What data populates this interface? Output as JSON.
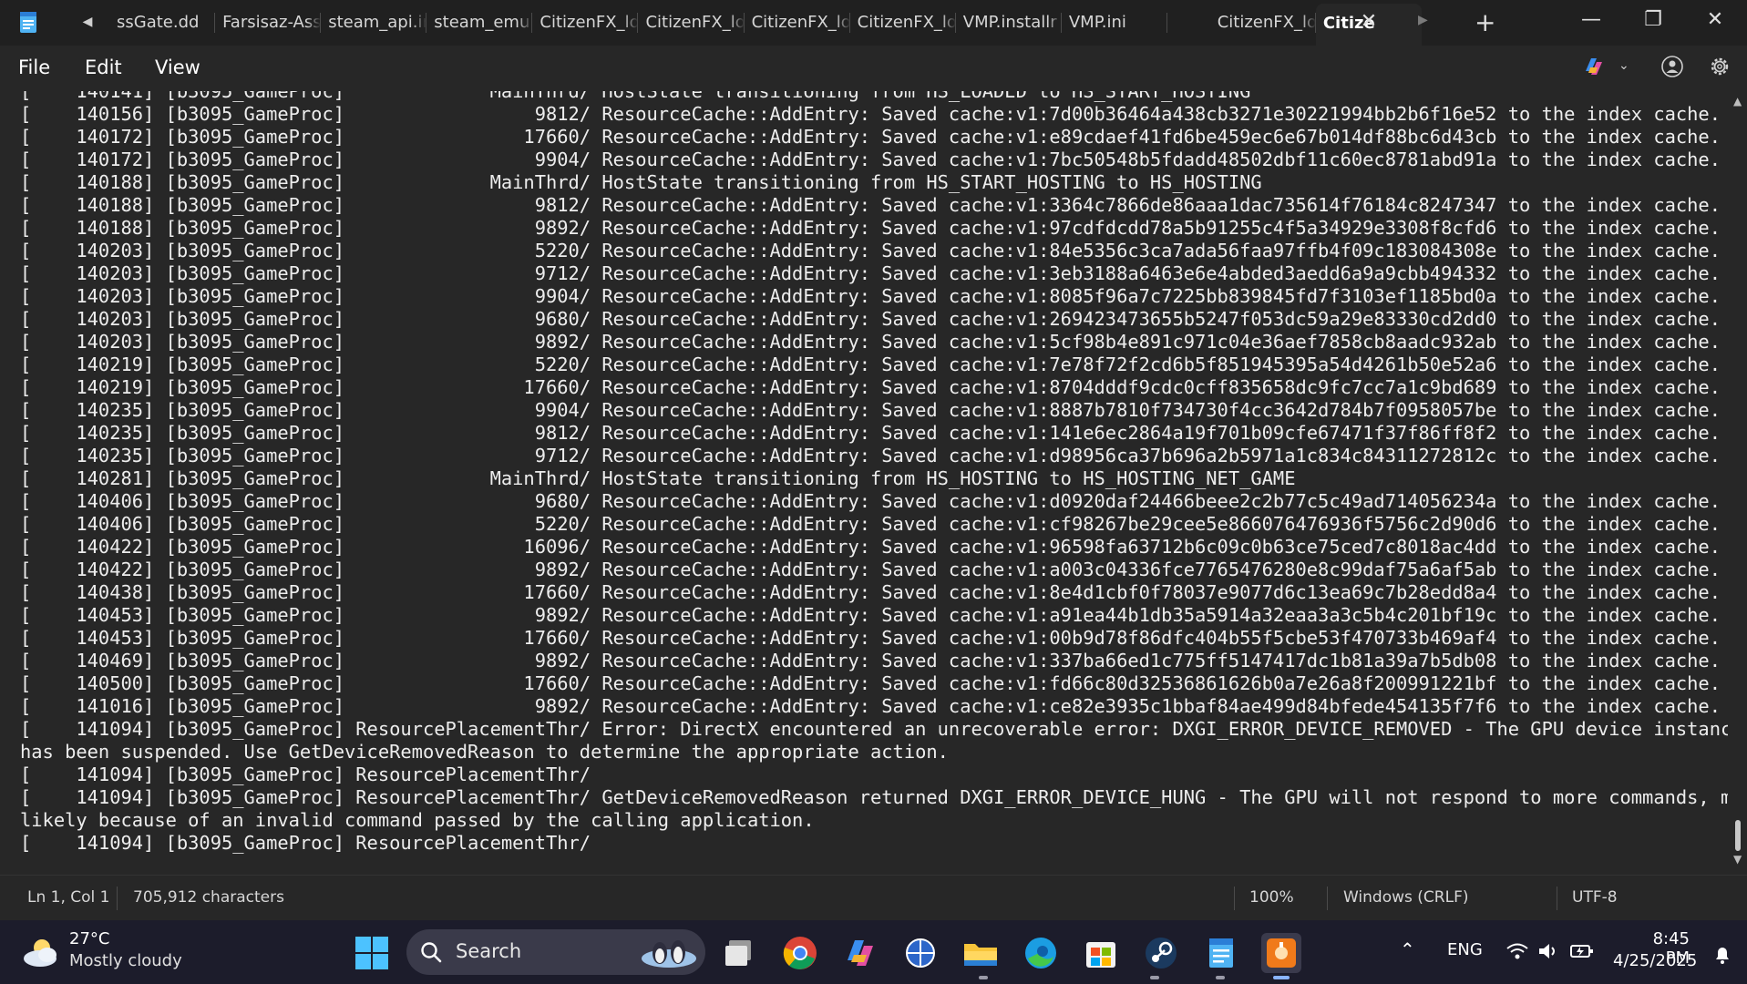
{
  "window": {
    "app": "Notepad",
    "tabs": [
      {
        "label": "ssGate.dd"
      },
      {
        "label": "Farsisaz-Assi"
      },
      {
        "label": "steam_api.in"
      },
      {
        "label": "steam_emu.i"
      },
      {
        "label": "CitizenFX_lo"
      },
      {
        "label": "CitizenFX_lo"
      },
      {
        "label": "CitizenFX_lo"
      },
      {
        "label": "CitizenFX_lo"
      },
      {
        "label": "VMP.installr"
      },
      {
        "label": "VMP.ini"
      },
      {
        "label": ""
      },
      {
        "label": "CitizenFX_lo"
      },
      {
        "label": "Citize"
      }
    ],
    "active_tab_index": 12,
    "close_glyph": "✕",
    "new_tab_glyph": "+",
    "minimize_glyph": "—",
    "restore_glyph": "❐",
    "close_window_glyph": "✕",
    "scroll_left_glyph": "◀",
    "scroll_right_glyph": "▶"
  },
  "menu": {
    "file": "File",
    "edit": "Edit",
    "view": "View"
  },
  "editor": {
    "lines": [
      "[    140141] [b3095_GameProc]             MainThrd/ HostState transitioning from HS_LOADED to HS_START_HOSTING",
      "[    140156] [b3095_GameProc]                 9812/ ResourceCache::AddEntry: Saved cache:v1:7d00b36464a438cb3271e30221994bb2b6f16e52 to the index cache.",
      "[    140172] [b3095_GameProc]                17660/ ResourceCache::AddEntry: Saved cache:v1:e89cdaef41fd6be459ec6e67b014df88bc6d43cb to the index cache.",
      "[    140172] [b3095_GameProc]                 9904/ ResourceCache::AddEntry: Saved cache:v1:7bc50548b5fdadd48502dbf11c60ec8781abd91a to the index cache.",
      "[    140188] [b3095_GameProc]             MainThrd/ HostState transitioning from HS_START_HOSTING to HS_HOSTING",
      "[    140188] [b3095_GameProc]                 9812/ ResourceCache::AddEntry: Saved cache:v1:3364c7866de86aaa1dac735614f76184c8247347 to the index cache.",
      "[    140188] [b3095_GameProc]                 9892/ ResourceCache::AddEntry: Saved cache:v1:97cdfdcdd78a5b91255c4f5a34929e3308f8cfd6 to the index cache.",
      "[    140203] [b3095_GameProc]                 5220/ ResourceCache::AddEntry: Saved cache:v1:84e5356c3ca7ada56faa97ffb4f09c183084308e to the index cache.",
      "[    140203] [b3095_GameProc]                 9712/ ResourceCache::AddEntry: Saved cache:v1:3eb3188a6463e6e4abded3aedd6a9a9cbb494332 to the index cache.",
      "[    140203] [b3095_GameProc]                 9904/ ResourceCache::AddEntry: Saved cache:v1:8085f96a7c7225bb839845fd7f3103ef1185bd0a to the index cache.",
      "[    140203] [b3095_GameProc]                 9680/ ResourceCache::AddEntry: Saved cache:v1:269423473655b5247f053dc59a29e83330cd2dd0 to the index cache.",
      "[    140203] [b3095_GameProc]                 9892/ ResourceCache::AddEntry: Saved cache:v1:5cf98b4e891c971c04e36aef7858cb8aadc932ab to the index cache.",
      "[    140219] [b3095_GameProc]                 5220/ ResourceCache::AddEntry: Saved cache:v1:7e78f72f2cd6b5f851945395a54d4261b50e52a6 to the index cache.",
      "[    140219] [b3095_GameProc]                17660/ ResourceCache::AddEntry: Saved cache:v1:8704dddf9cdc0cff835658dc9fc7cc7a1c9bd689 to the index cache.",
      "[    140235] [b3095_GameProc]                 9904/ ResourceCache::AddEntry: Saved cache:v1:8887b7810f734730f4cc3642d784b7f0958057be to the index cache.",
      "[    140235] [b3095_GameProc]                 9812/ ResourceCache::AddEntry: Saved cache:v1:141e6ec2864a19f701b09cfe67471f37f86ff8f2 to the index cache.",
      "[    140235] [b3095_GameProc]                 9712/ ResourceCache::AddEntry: Saved cache:v1:d98956ca37b696a2b5971a1c834c84311272812c to the index cache.",
      "[    140281] [b3095_GameProc]             MainThrd/ HostState transitioning from HS_HOSTING to HS_HOSTING_NET_GAME",
      "[    140406] [b3095_GameProc]                 9680/ ResourceCache::AddEntry: Saved cache:v1:d0920daf24466beee2c2b77c5c49ad714056234a to the index cache.",
      "[    140406] [b3095_GameProc]                 5220/ ResourceCache::AddEntry: Saved cache:v1:cf98267be29cee5e866076476936f5756c2d90d6 to the index cache.",
      "[    140422] [b3095_GameProc]                16096/ ResourceCache::AddEntry: Saved cache:v1:96598fa63712b6c09c0b63ce75ced7c8018ac4dd to the index cache.",
      "[    140422] [b3095_GameProc]                 9892/ ResourceCache::AddEntry: Saved cache:v1:a003c04336fce7765476280e8c99daf75a6af5ab to the index cache.",
      "[    140438] [b3095_GameProc]                17660/ ResourceCache::AddEntry: Saved cache:v1:8e4d1cbf0f78037e9077d6c13ea69c7b28edd8a4 to the index cache.",
      "[    140453] [b3095_GameProc]                 9892/ ResourceCache::AddEntry: Saved cache:v1:a91ea44b1db35a5914a32eaa3a3c5b4c201bf19c to the index cache.",
      "[    140453] [b3095_GameProc]                17660/ ResourceCache::AddEntry: Saved cache:v1:00b9d78f86dfc404b55f5cbe53f470733b469af4 to the index cache.",
      "[    140469] [b3095_GameProc]                 9892/ ResourceCache::AddEntry: Saved cache:v1:337ba66ed1c775ff5147417dc1b81a39a7b5db08 to the index cache.",
      "[    140500] [b3095_GameProc]                17660/ ResourceCache::AddEntry: Saved cache:v1:fd66c80d32536861626b0a7e26a8f200991221bf to the index cache.",
      "[    141016] [b3095_GameProc]                 9892/ ResourceCache::AddEntry: Saved cache:v1:ce82e3935c1bbaf84ae499d84bfede454135f7f6 to the index cache.",
      "[    141094] [b3095_GameProc] ResourcePlacementThr/ Error: DirectX encountered an unrecoverable error: DXGI_ERROR_DEVICE_REMOVED - The GPU device instance",
      "has been suspended. Use GetDeviceRemovedReason to determine the appropriate action.",
      "[    141094] [b3095_GameProc] ResourcePlacementThr/",
      "[    141094] [b3095_GameProc] ResourcePlacementThr/ GetDeviceRemovedReason returned DXGI_ERROR_DEVICE_HUNG - The GPU will not respond to more commands, most",
      "likely because of an invalid command passed by the calling application.",
      "[    141094] [b3095_GameProc] ResourcePlacementThr/"
    ]
  },
  "status": {
    "position": "Ln 1, Col 1",
    "characters": "705,912 characters",
    "zoom": "100%",
    "line_ending": "Windows (CRLF)",
    "encoding": "UTF-8"
  },
  "taskbar": {
    "weather_temp": "27°C",
    "weather_condition": "Mostly cloudy",
    "search_label": "Search",
    "language": "ENG",
    "time": "8:45 PM",
    "date": "4/25/2025",
    "pinned": [
      "windows-start",
      "search",
      "task-view",
      "chrome",
      "copilot",
      "vpn-globe",
      "file-explorer",
      "edge",
      "microsoft-store",
      "steam",
      "notepad",
      "paint-app"
    ]
  },
  "colors": {
    "background": "#272727",
    "tabbar": "#202020",
    "taskbar": "#1c1c2b",
    "text": "#ededed"
  }
}
